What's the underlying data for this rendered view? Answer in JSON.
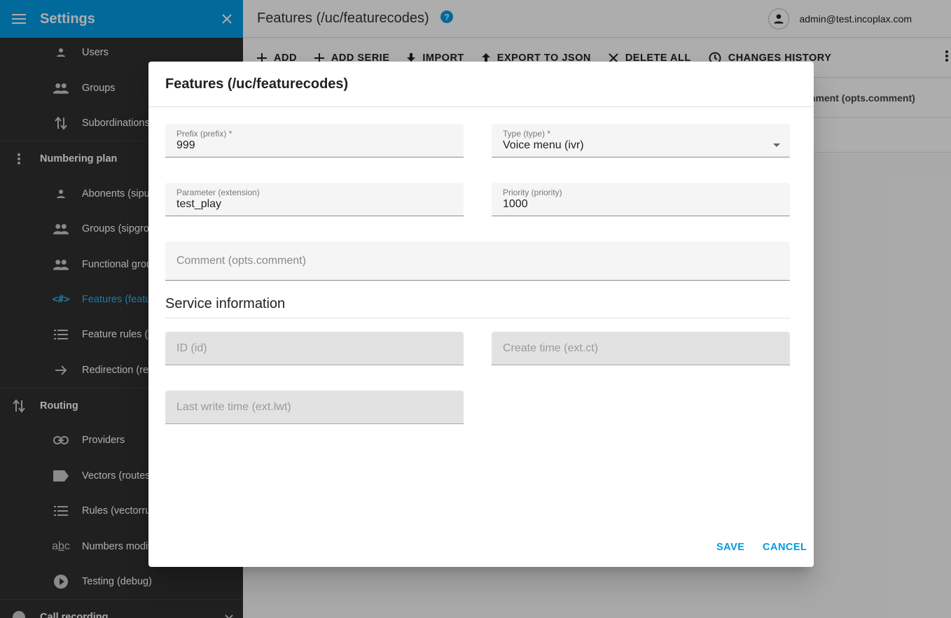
{
  "sidebar": {
    "title": "Settings",
    "items": [
      {
        "label": "Users",
        "icon": "person-icon"
      },
      {
        "label": "Groups",
        "icon": "people-icon"
      },
      {
        "label": "Subordinations",
        "icon": "swap-vertical-icon"
      },
      {
        "label": "Numbering plan",
        "icon": "more-vertical-icon"
      },
      {
        "label": "Abonents (sipu",
        "icon": "person-icon"
      },
      {
        "label": "Groups (sipgrou",
        "icon": "people-icon"
      },
      {
        "label": "Functional grou",
        "icon": "people-icon"
      },
      {
        "label": "Features (featu",
        "icon": "code-hash-icon"
      },
      {
        "label": "Feature rules (f",
        "icon": "list-icon"
      },
      {
        "label": "Redirection (rec",
        "icon": "arrow-right-icon"
      },
      {
        "label": "Routing",
        "icon": "swap-vertical-icon"
      },
      {
        "label": "Providers",
        "icon": "link-icon"
      },
      {
        "label": "Vectors (routes",
        "icon": "label-icon"
      },
      {
        "label": "Rules (vectorru",
        "icon": "list-icon"
      },
      {
        "label": "Numbers modif",
        "icon": "abc-icon"
      },
      {
        "label": "Testing (debug)",
        "icon": "play-circle-icon"
      },
      {
        "label": "Call recording",
        "icon": "record-icon"
      }
    ]
  },
  "header": {
    "title": "Features (/uc/featurecodes)",
    "user": "admin@test.incoplax.com"
  },
  "toolbar": {
    "add": "ADD",
    "add_serie": "ADD SERIE",
    "import": "IMPORT",
    "export": "EXPORT TO JSON",
    "delete_all": "DELETE ALL",
    "history": "CHANGES HISTORY"
  },
  "table": {
    "column_comment": "mment (opts.comment)"
  },
  "dialog": {
    "title": "Features (/uc/featurecodes)",
    "prefix": {
      "label": "Prefix (prefix) *",
      "value": "999"
    },
    "type": {
      "label": "Type (type) *",
      "value": "Voice menu (ivr)"
    },
    "parameter": {
      "label": "Parameter (extension)",
      "value": "test_play"
    },
    "priority": {
      "label": "Priority (priority)",
      "value": "1000"
    },
    "comment": {
      "placeholder": "Comment (opts.comment)"
    },
    "service_title": "Service information",
    "id": {
      "placeholder": "ID (id)"
    },
    "create_time": {
      "placeholder": "Create time (ext.ct)"
    },
    "last_write": {
      "placeholder": "Last write time (ext.lwt)"
    },
    "save": "SAVE",
    "cancel": "CANCEL"
  },
  "colors": {
    "accent": "#039be5",
    "sidebar_bg": "#303030",
    "active": "#29b6f6"
  }
}
